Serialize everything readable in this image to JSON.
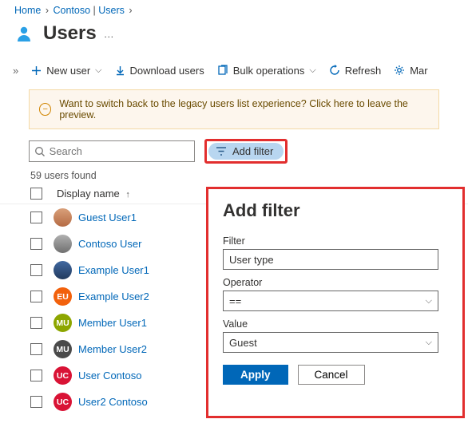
{
  "breadcrumb": {
    "home": "Home",
    "tenant": "Contoso",
    "section": "Users"
  },
  "page": {
    "title": "Users",
    "more": "…"
  },
  "toolbar": {
    "new_user": "New user",
    "download": "Download users",
    "bulk": "Bulk operations",
    "refresh": "Refresh",
    "manage": "Mar"
  },
  "banner": {
    "text": "Want to switch back to the legacy users list experience? Click here to leave the preview."
  },
  "search": {
    "placeholder": "Search"
  },
  "add_filter": {
    "label": "Add filter"
  },
  "results": {
    "count_text": "59 users found"
  },
  "table": {
    "col_display": "Display name",
    "rows": [
      {
        "initials": "",
        "avatar_class": "av-photo1",
        "name": "Guest User1"
      },
      {
        "initials": "",
        "avatar_class": "av-photo2",
        "name": "Contoso User"
      },
      {
        "initials": "",
        "avatar_class": "av-photo3",
        "name": "Example User1"
      },
      {
        "initials": "EU",
        "avatar_class": "av-eu",
        "name": "Example User2"
      },
      {
        "initials": "MU",
        "avatar_class": "av-mu",
        "name": "Member User1"
      },
      {
        "initials": "MU",
        "avatar_class": "av-mu2",
        "name": "Member User2"
      },
      {
        "initials": "UC",
        "avatar_class": "av-uc",
        "name": "User Contoso"
      },
      {
        "initials": "UC",
        "avatar_class": "av-uc",
        "name": "User2 Contoso"
      }
    ]
  },
  "filter_panel": {
    "title": "Add filter",
    "filter_label": "Filter",
    "filter_value": "User type",
    "operator_label": "Operator",
    "operator_value": "==",
    "value_label": "Value",
    "value_value": "Guest",
    "apply": "Apply",
    "cancel": "Cancel"
  }
}
